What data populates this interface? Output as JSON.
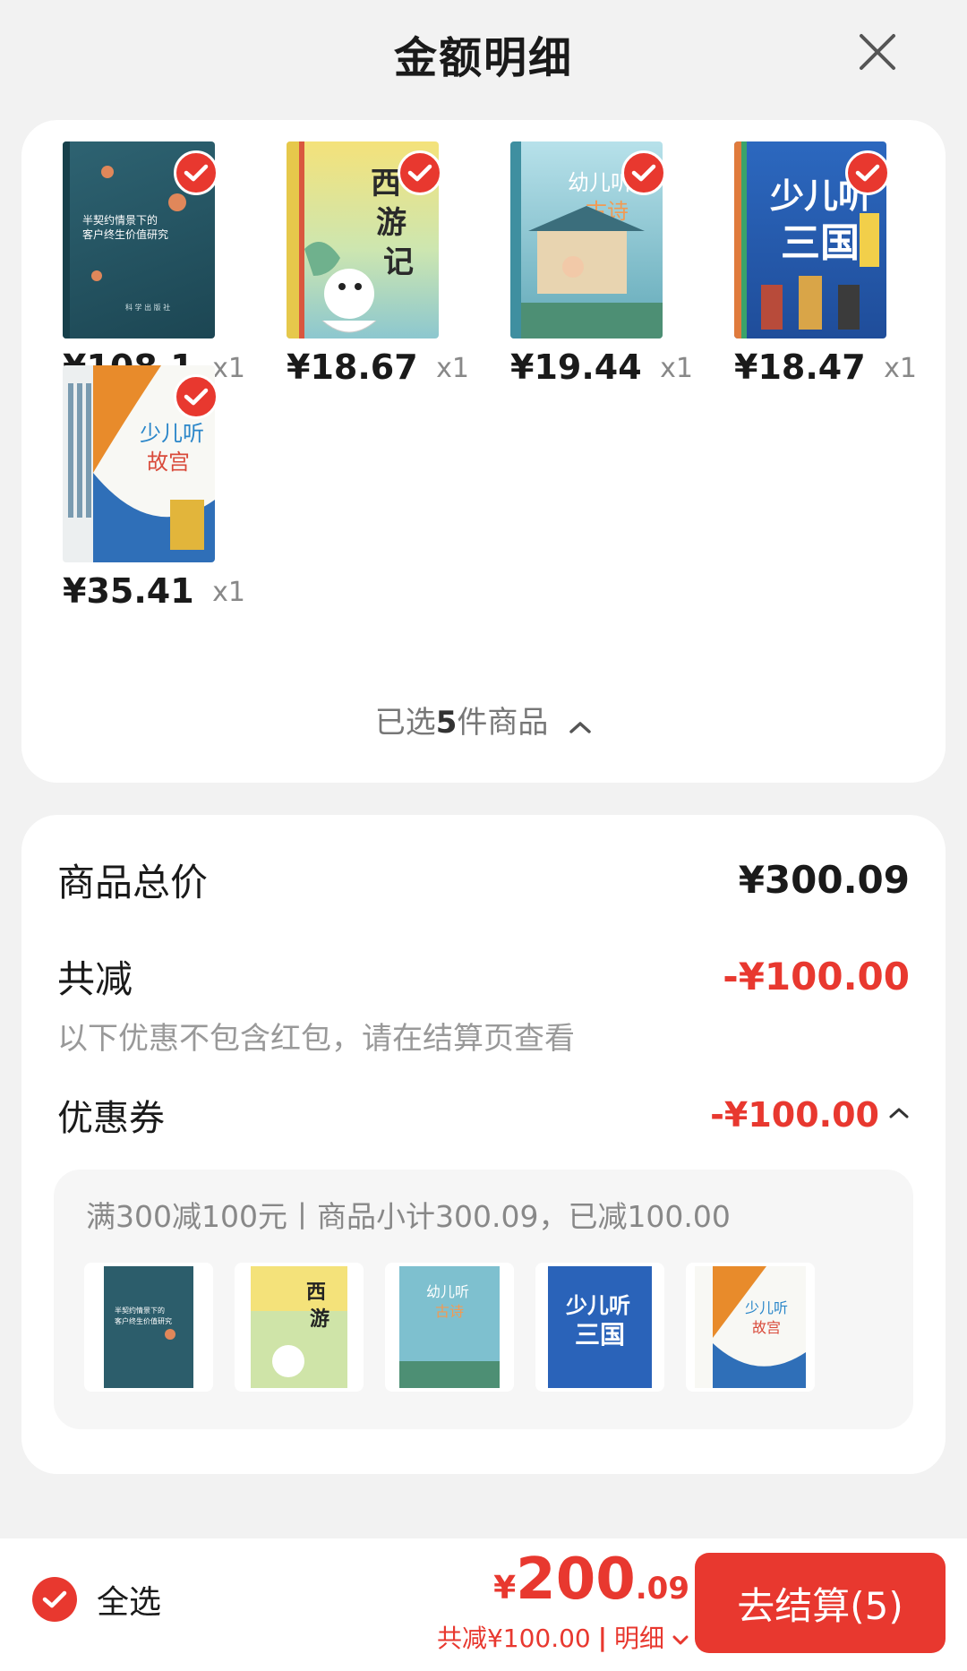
{
  "header": {
    "title": "金额明细"
  },
  "items": [
    {
      "price": "¥108.1",
      "qty": "x1",
      "cover_name": "book-cover-customer-value",
      "cover_text": "半契约情景下的客户终生价值研究",
      "colors": [
        "#2c5d6b",
        "#1f4a57"
      ]
    },
    {
      "price": "¥18.67",
      "qty": "x1",
      "cover_name": "book-cover-xiyouji",
      "cover_text": "西游记",
      "colors": [
        "#f3e37c",
        "#7fc2c8"
      ]
    },
    {
      "price": "¥19.44",
      "qty": "x1",
      "cover_name": "book-cover-youer-ting-gushi",
      "cover_text": "幼儿听古诗",
      "colors": [
        "#9fd3e0",
        "#3d8fa3"
      ]
    },
    {
      "price": "¥18.47",
      "qty": "x1",
      "cover_name": "book-cover-shaoer-ting-sanguo",
      "cover_text": "少儿听三国",
      "colors": [
        "#2a63b9",
        "#1d3f86"
      ]
    },
    {
      "price": "¥35.41",
      "qty": "x1",
      "cover_name": "book-cover-shaoer-ting-gugong",
      "cover_text": "少儿听故宫",
      "colors": [
        "#f7f7f2",
        "#e88b2b"
      ]
    }
  ],
  "selected": {
    "prefix": "已选",
    "count": "5",
    "suffix": "件商品"
  },
  "summary": {
    "goods_total_label": "商品总价",
    "goods_total_value": "¥300.09",
    "discount_label": "共减",
    "discount_value": "-¥100.00",
    "discount_note": "以下优惠不包含红包，请在结算页查看",
    "coupon_label": "优惠券",
    "coupon_value": "-¥100.00",
    "coupon_desc": "满300减100元丨商品小计300.09，已减100.00"
  },
  "bottom": {
    "select_all": "全选",
    "currency": "¥",
    "total_int": "200",
    "total_dec": ".09",
    "saved": "共减¥100.00",
    "separator": "|",
    "detail": "明细",
    "checkout": "去结算(5)"
  },
  "colors": {
    "accent": "#e8382f"
  },
  "icons": {
    "close": "close-icon",
    "check": "checkmark-icon",
    "chevron_up": "chevron-up-icon",
    "chevron_down": "chevron-down-icon"
  }
}
